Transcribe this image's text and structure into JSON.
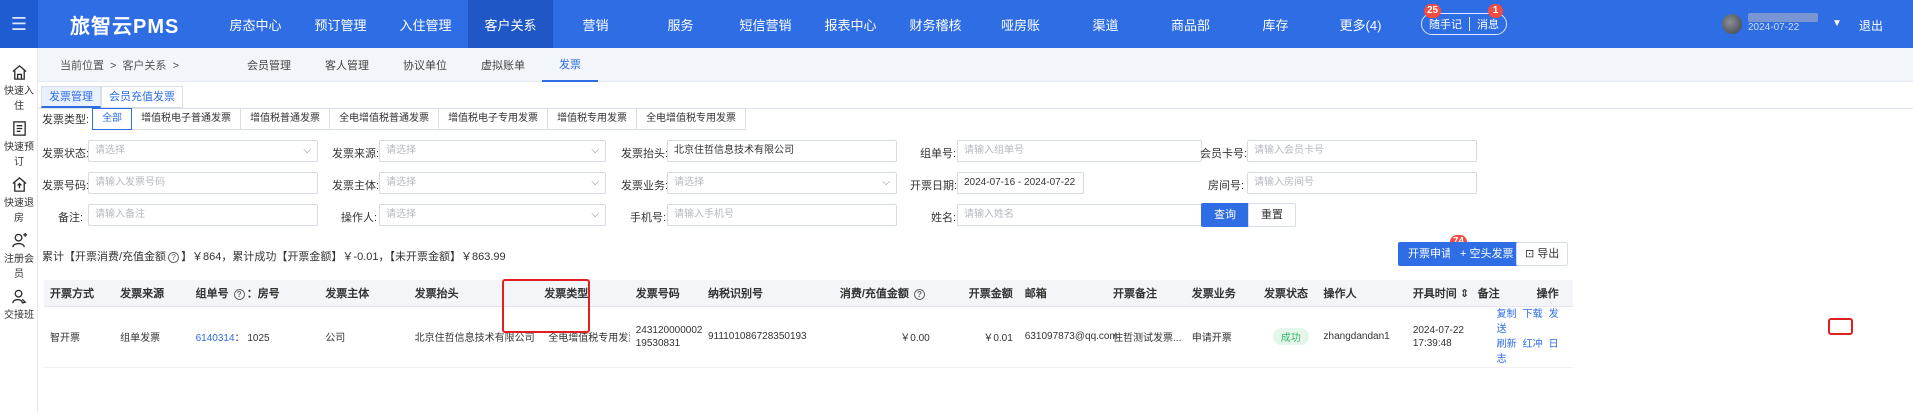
{
  "app": {
    "brand": "旅智云PMS",
    "nav": [
      "房态中心",
      "预订管理",
      "入住管理",
      "客户关系",
      "营销",
      "服务",
      "短信营销",
      "报表中心",
      "财务稽核",
      "哑房账",
      "渠道",
      "商品部",
      "库存",
      "更多(4)"
    ],
    "nav_active": "客户关系",
    "notes_label": "随手记",
    "notes_badge": "25",
    "msg_label": "消息",
    "msg_badge": "1",
    "user_date": "2024-07-22",
    "logout": "退出"
  },
  "sidebar": [
    "快速入住",
    "快速预订",
    "快速退房",
    "注册会员",
    "交接班"
  ],
  "breadcrumb": {
    "prefix": "当前位置",
    "section": "客户关系"
  },
  "subnav": [
    "会员管理",
    "客人管理",
    "协议单位",
    "虚拟账单",
    "发票"
  ],
  "tabs": [
    "发票管理",
    "会员充值发票"
  ],
  "invoice_type": {
    "label": "发票类型:",
    "options": [
      "全部",
      "增值税电子普通发票",
      "增值税普通发票",
      "全电增值税普通发票",
      "增值税电子专用发票",
      "增值税专用发票",
      "全电增值税专用发票"
    ]
  },
  "filters": {
    "status_label": "发票状态:",
    "status_ph": "请选择",
    "source_label": "发票来源:",
    "source_ph": "请选择",
    "title_label": "发票抬头:",
    "title_value": "北京住哲信息技术有限公司",
    "group_label": "组单号:",
    "group_ph": "请输入组单号",
    "card_label": "会员卡号:",
    "card_ph": "请输入会员卡号",
    "number_label": "发票号码:",
    "number_ph": "请输入发票号码",
    "entity_label": "发票主体:",
    "entity_ph": "请选择",
    "biz_label": "发票业务:",
    "biz_ph": "请选择",
    "date_label": "开票日期:",
    "date_value": "2024-07-16 - 2024-07-22",
    "room_label": "房间号:",
    "room_ph": "请输入房间号",
    "remark_label": "备注:",
    "remark_ph": "请输入备注",
    "operator_label": "操作人:",
    "operator_ph": "请选择",
    "phone_label": "手机号:",
    "phone_ph": "请输入手机号",
    "name_label": "姓名:",
    "name_ph": "请输入姓名",
    "query": "查询",
    "reset": "重置"
  },
  "summary": {
    "part1": "累计【开票消费/充值金额",
    "part2": "】￥864，累计成功【开票金额】￥-0.01，【未开票金额】￥863.99"
  },
  "actions": {
    "apply": "开票申请",
    "apply_badge": "74",
    "blank": "+ 空头发票",
    "export": "导出"
  },
  "table": {
    "headers": [
      "开票方式",
      "发票来源",
      "组单号",
      "房号",
      "发票主体",
      "发票抬头",
      "发票类型",
      "发票号码",
      "纳税识别号",
      "消费/充值金额",
      "开票金额",
      "邮箱",
      "开票备注",
      "发票业务",
      "发票状态",
      "操作人",
      "开具时间",
      "备注",
      "操作"
    ],
    "rows": [
      {
        "method": "智开票",
        "source": "组单发票",
        "group_no": "6140314",
        "room": "1025",
        "entity": "公司",
        "title": "北京住哲信息技术有限公司",
        "type": "全电增值税专用发票",
        "number_1": "243120000002",
        "number_2": "19530831",
        "tax_id": "911101086728350193",
        "amount": "￥0.00",
        "invoice_amount": "￥0.01",
        "email": "631097873@qq.com",
        "note": "住哲测试发票...",
        "business": "申请开票",
        "status": "成功",
        "operator": "zhangdandan1",
        "time_1": "2024-07-22",
        "time_2": "17:39:48",
        "ops": [
          "复制",
          "下载",
          "发送",
          "刷新",
          "红冲",
          "日志"
        ]
      }
    ]
  },
  "colors": {
    "primary": "#2e6de3",
    "highlight": "#e02020",
    "success": "#3bb56d"
  }
}
